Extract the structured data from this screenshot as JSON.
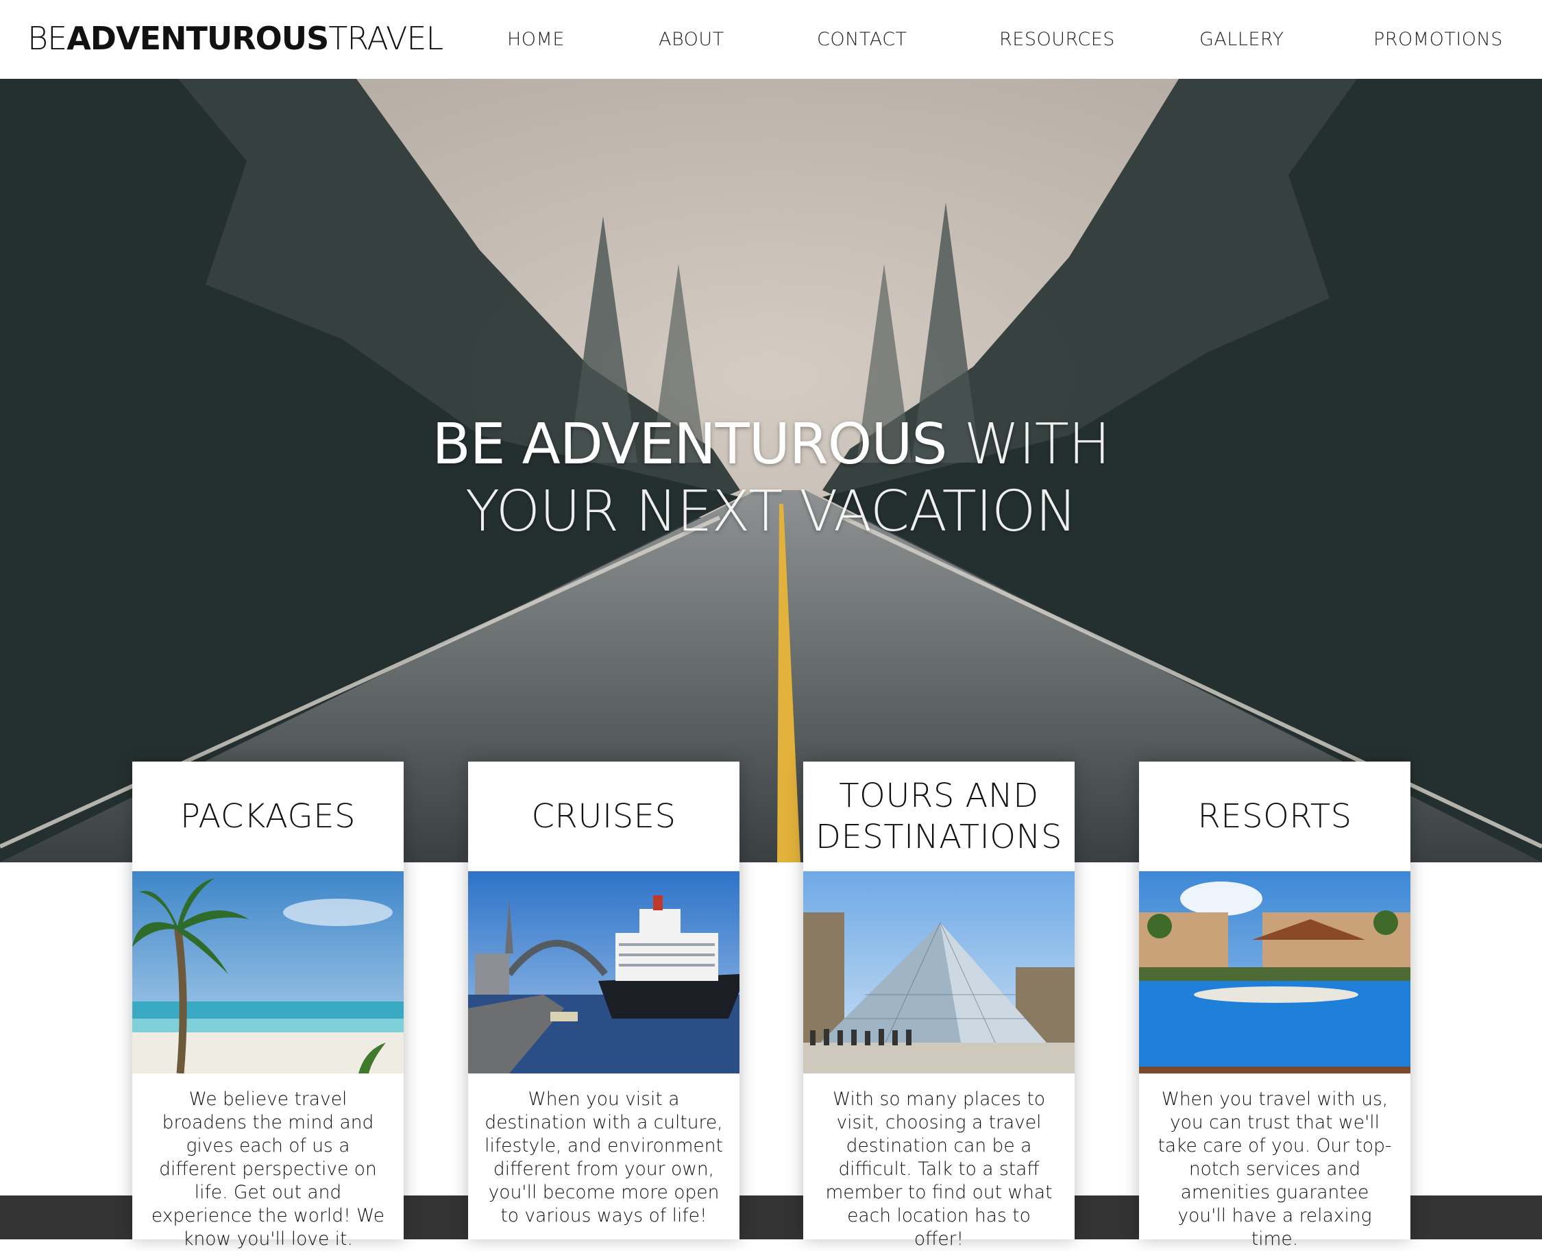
{
  "header": {
    "logo": {
      "part1": "BE",
      "part2": "ADVENTUROUS",
      "part3": "TRAVEL"
    },
    "nav": [
      {
        "label": "HOME"
      },
      {
        "label": "ABOUT"
      },
      {
        "label": "CONTACT"
      },
      {
        "label": "RESOURCES"
      },
      {
        "label": "GALLERY"
      },
      {
        "label": "PROMOTIONS"
      }
    ]
  },
  "hero": {
    "line1_strong": "BE ADVENTUROUS",
    "line1_light": " WITH",
    "line2": "YOUR NEXT VACATION"
  },
  "cards": [
    {
      "title": "PACKAGES",
      "text": "We believe travel broadens the mind and gives each of us a different perspective on life. Get out and experience the world! We know you'll love it."
    },
    {
      "title": "CRUISES",
      "text": "When you visit a destination with a culture, lifestyle, and environment different from your own, you'll become more open to various ways of life!"
    },
    {
      "title": "TOURS AND DESTINATIONS",
      "text": "With so many places to visit, choosing a travel destination can be a difficult. Talk to a staff member to find out what each location has to offer!"
    },
    {
      "title": "RESORTS",
      "text": "When you travel with us, you can trust that we'll take care of you. Our top-notch services and amenities guarantee you'll have a relaxing time."
    }
  ],
  "colors": {
    "footer": "#333333",
    "road_line": "#e3b23c"
  }
}
